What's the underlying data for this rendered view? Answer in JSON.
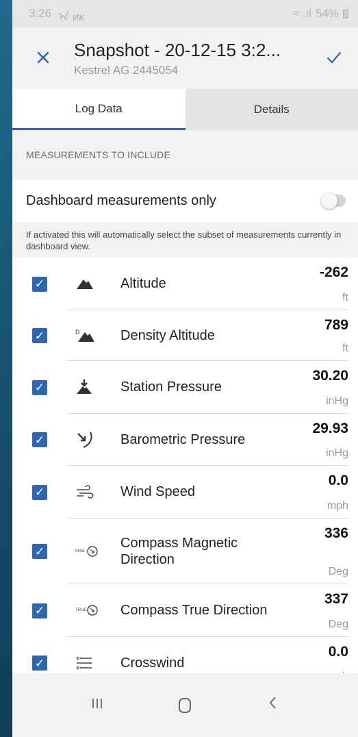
{
  "status_bar": {
    "time": "3:26",
    "left_icons": "ᠠ ᴎᴋ",
    "battery": "54%",
    "signal": "≈ .ıl"
  },
  "header": {
    "title": "Snapshot - 20-12-15 3:2...",
    "subtitle": "Kestrel AG 2445054"
  },
  "tabs": [
    {
      "label": "Log Data",
      "active": true
    },
    {
      "label": "Details",
      "active": false
    }
  ],
  "section_label": "MEASUREMENTS TO INCLUDE",
  "dashboard_toggle": {
    "label": "Dashboard measurements only",
    "on": false
  },
  "note": "If activated this will automatically select the subset of measurements currently in dashboard view.",
  "measurements": [
    {
      "name": "Altitude",
      "value": "-262",
      "unit": "ft",
      "icon": "mountain-icon",
      "checked": true
    },
    {
      "name": "Density Altitude",
      "value": "789",
      "unit": "ft",
      "icon": "density-altitude-icon",
      "checked": true
    },
    {
      "name": "Station Pressure",
      "value": "30.20",
      "unit": "inHg",
      "icon": "station-pressure-icon",
      "checked": true
    },
    {
      "name": "Barometric Pressure",
      "value": "29.93",
      "unit": "inHg",
      "icon": "barometric-pressure-icon",
      "checked": true
    },
    {
      "name": "Wind Speed",
      "value": "0.0",
      "unit": "mph",
      "icon": "wind-icon",
      "checked": true
    },
    {
      "name": "Compass Magnetic Direction",
      "value": "336",
      "unit": "Deg",
      "icon": "compass-magnetic-icon",
      "checked": true
    },
    {
      "name": "Compass True Direction",
      "value": "337",
      "unit": "Deg",
      "icon": "compass-true-icon",
      "checked": true
    },
    {
      "name": "Crosswind",
      "value": "0.0",
      "unit": "mph",
      "icon": "crosswind-icon",
      "checked": true
    }
  ],
  "colors": {
    "accent": "#2f66b3",
    "background": "#f2f2f2"
  }
}
